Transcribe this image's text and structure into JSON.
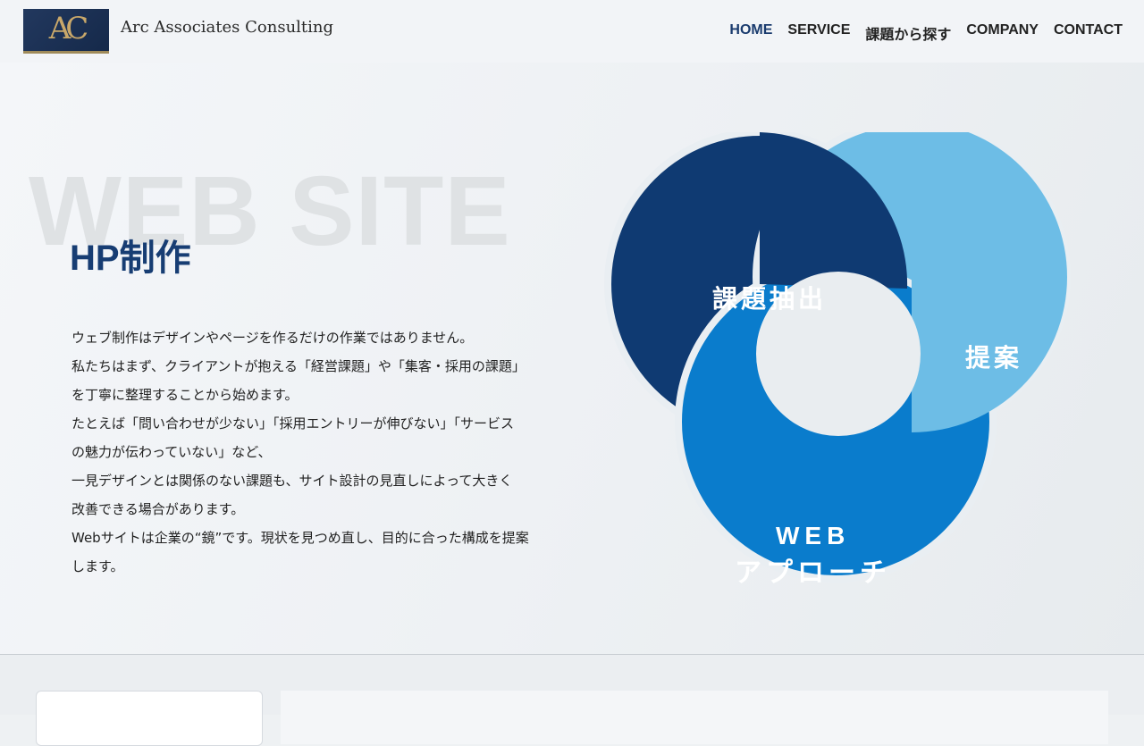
{
  "header": {
    "logo_mark": "AC",
    "company_name": "Arc Associates Consulting",
    "nav": [
      {
        "label": "HOME",
        "active": true
      },
      {
        "label": "SERVICE",
        "active": false
      },
      {
        "label": "課題から探す",
        "active": false
      },
      {
        "label": "COMPANY",
        "active": false
      },
      {
        "label": "CONTACT",
        "active": false
      }
    ]
  },
  "hero": {
    "background_word": "WEB SITE",
    "title": "HP制作",
    "paragraphs": [
      "ウェブ制作はデザインやページを作るだけの作業ではありません。",
      "私たちはまず、クライアントが抱える「経営課題」や「集客・採用の課題」",
      "を丁寧に整理することから始めます。",
      "たとえば「問い合わせが少ない」「採用エントリーが伸びない」「サービス",
      "の魅力が伝わっていない」など、",
      "一見デザインとは関係のない課題も、サイト設計の見直しによって大きく",
      "改善できる場合があります。",
      "Webサイトは企業の“鏡”です。現状を見つめ直し、目的に合った構成を提案",
      "します。"
    ]
  },
  "diagram": {
    "segments": [
      {
        "label_lines": [
          "課題抽出"
        ],
        "color": "#0f3a72"
      },
      {
        "label_lines": [
          "提案"
        ],
        "color": "#6dbde6"
      },
      {
        "label_lines": [
          "WEB",
          "アプローチ"
        ],
        "color": "#0a7ccc"
      }
    ]
  },
  "colors": {
    "accent": "#1a3b6e",
    "dark_navy": "#0f3a72",
    "light_blue": "#6dbde6",
    "mid_blue": "#0a7ccc"
  }
}
